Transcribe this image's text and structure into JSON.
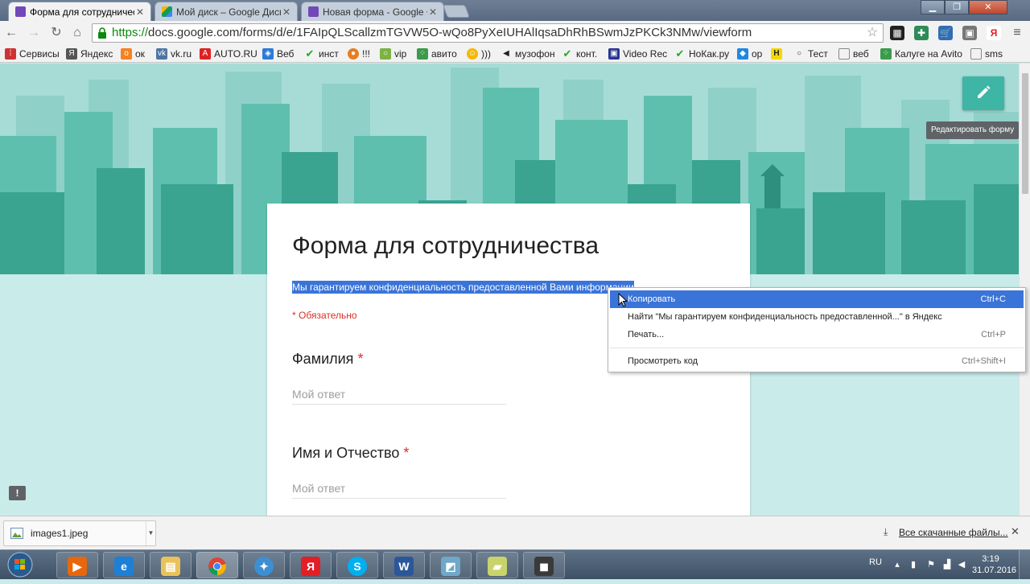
{
  "tabs": [
    {
      "label": "Форма для сотрудничест",
      "color": "#7248b9"
    },
    {
      "label": "Мой диск – Google Диск",
      "color": "#4a90e2"
    },
    {
      "label": "Новая форма - Google Ф",
      "color": "#7248b9"
    }
  ],
  "toolbar": {
    "url_scheme": "https://",
    "url_rest": "docs.google.com/forms/d/e/1FAIpQLScallzmTGVW5O-wQo8PyXeIUHAlIqsaDhRhBSwmJzPKCk3NMw/viewform"
  },
  "bookmarks": [
    {
      "label": "Сервисы"
    },
    {
      "label": "Яндекс"
    },
    {
      "label": "ок"
    },
    {
      "label": "vk.ru"
    },
    {
      "label": "AUTO.RU"
    },
    {
      "label": "Веб"
    },
    {
      "label": "инст"
    },
    {
      "label": "!!!"
    },
    {
      "label": "vip"
    },
    {
      "label": "авито"
    },
    {
      "label": ")))"
    },
    {
      "label": "музофон"
    },
    {
      "label": "конт."
    },
    {
      "label": "Video Rec"
    },
    {
      "label": "НоКак.ру"
    },
    {
      "label": "ор"
    },
    {
      "label": ""
    },
    {
      "label": "Тест"
    },
    {
      "label": "веб"
    },
    {
      "label": "Калуге на Avito"
    },
    {
      "label": "sms"
    }
  ],
  "page": {
    "edit_tooltip": "Редактировать форму",
    "form_title": "Форма для сотрудничества",
    "form_description": "Мы гарантируем конфиденциальность предоставленной Вами информации",
    "required_note": "* Обязательно",
    "questions": [
      {
        "title": "Фамилия",
        "required_mark": "*",
        "placeholder": "Мой ответ"
      },
      {
        "title": "Имя и Отчество",
        "required_mark": "*",
        "placeholder": "Мой ответ"
      }
    ],
    "accent_color": "#3fb5a5",
    "error_color": "#d93025"
  },
  "context_menu": {
    "items": [
      {
        "label": "Копировать",
        "shortcut": "Ctrl+C"
      },
      {
        "label": "Найти \"Мы гарантируем конфиденциальность предоставленной...\" в Яндекс",
        "shortcut": ""
      },
      {
        "label": "Печать...",
        "shortcut": "Ctrl+P"
      },
      {
        "label": "Просмотреть код",
        "shortcut": "Ctrl+Shift+I"
      }
    ]
  },
  "download_bar": {
    "file_name": "images1.jpeg",
    "show_all": "Все скачанные файлы..."
  },
  "taskbar": {
    "lang": "RU",
    "time": "3:19",
    "date": "31.07.2016"
  }
}
